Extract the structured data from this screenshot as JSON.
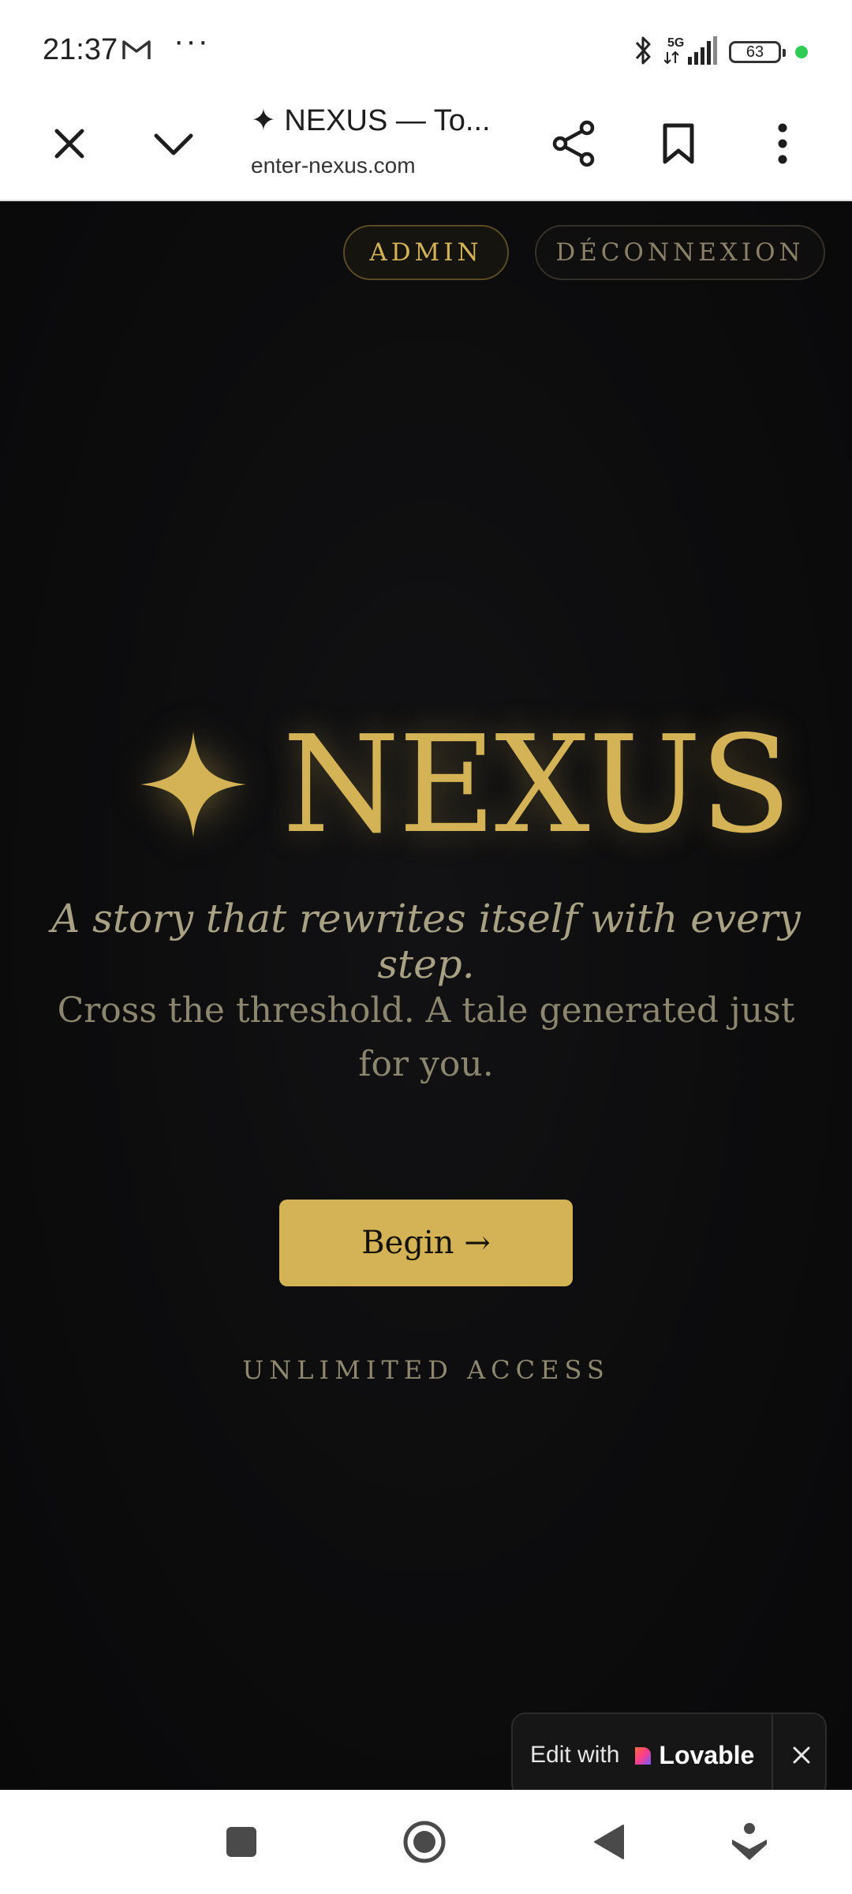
{
  "status_bar": {
    "time": "21:37",
    "mail_icon": "gmail-icon",
    "more_label": "···",
    "network": "5G",
    "battery_level": "63",
    "indicator_color": "#2ecc55"
  },
  "browser": {
    "tab_title": "✦ NEXUS — To...",
    "url": "enter-nexus.com",
    "icons": [
      "close-icon",
      "chevron-down-icon",
      "share-icon",
      "bookmark-icon",
      "more-vert-icon"
    ]
  },
  "page": {
    "nav": {
      "admin_label": "ADMIN",
      "logout_label": "DÉCONNEXION"
    },
    "hero": {
      "star_icon": "four-point-star-icon",
      "title": "NEXUS"
    },
    "tagline": "A story that rewrites itself with every step.",
    "subtext": "Cross the threshold. A tale generated just for you.",
    "cta_label": "Begin →",
    "access_label": "UNLIMITED ACCESS",
    "colors": {
      "gold": "#d4b357",
      "background": "#0c0c0d",
      "muted_text": "#8c866f"
    }
  },
  "badge": {
    "prefix": "Edit with",
    "brand": "Lovable",
    "close_icon": "close-icon"
  },
  "navbar": {
    "icons": [
      "recent-apps-icon",
      "home-icon",
      "back-icon",
      "assistant-icon"
    ]
  }
}
